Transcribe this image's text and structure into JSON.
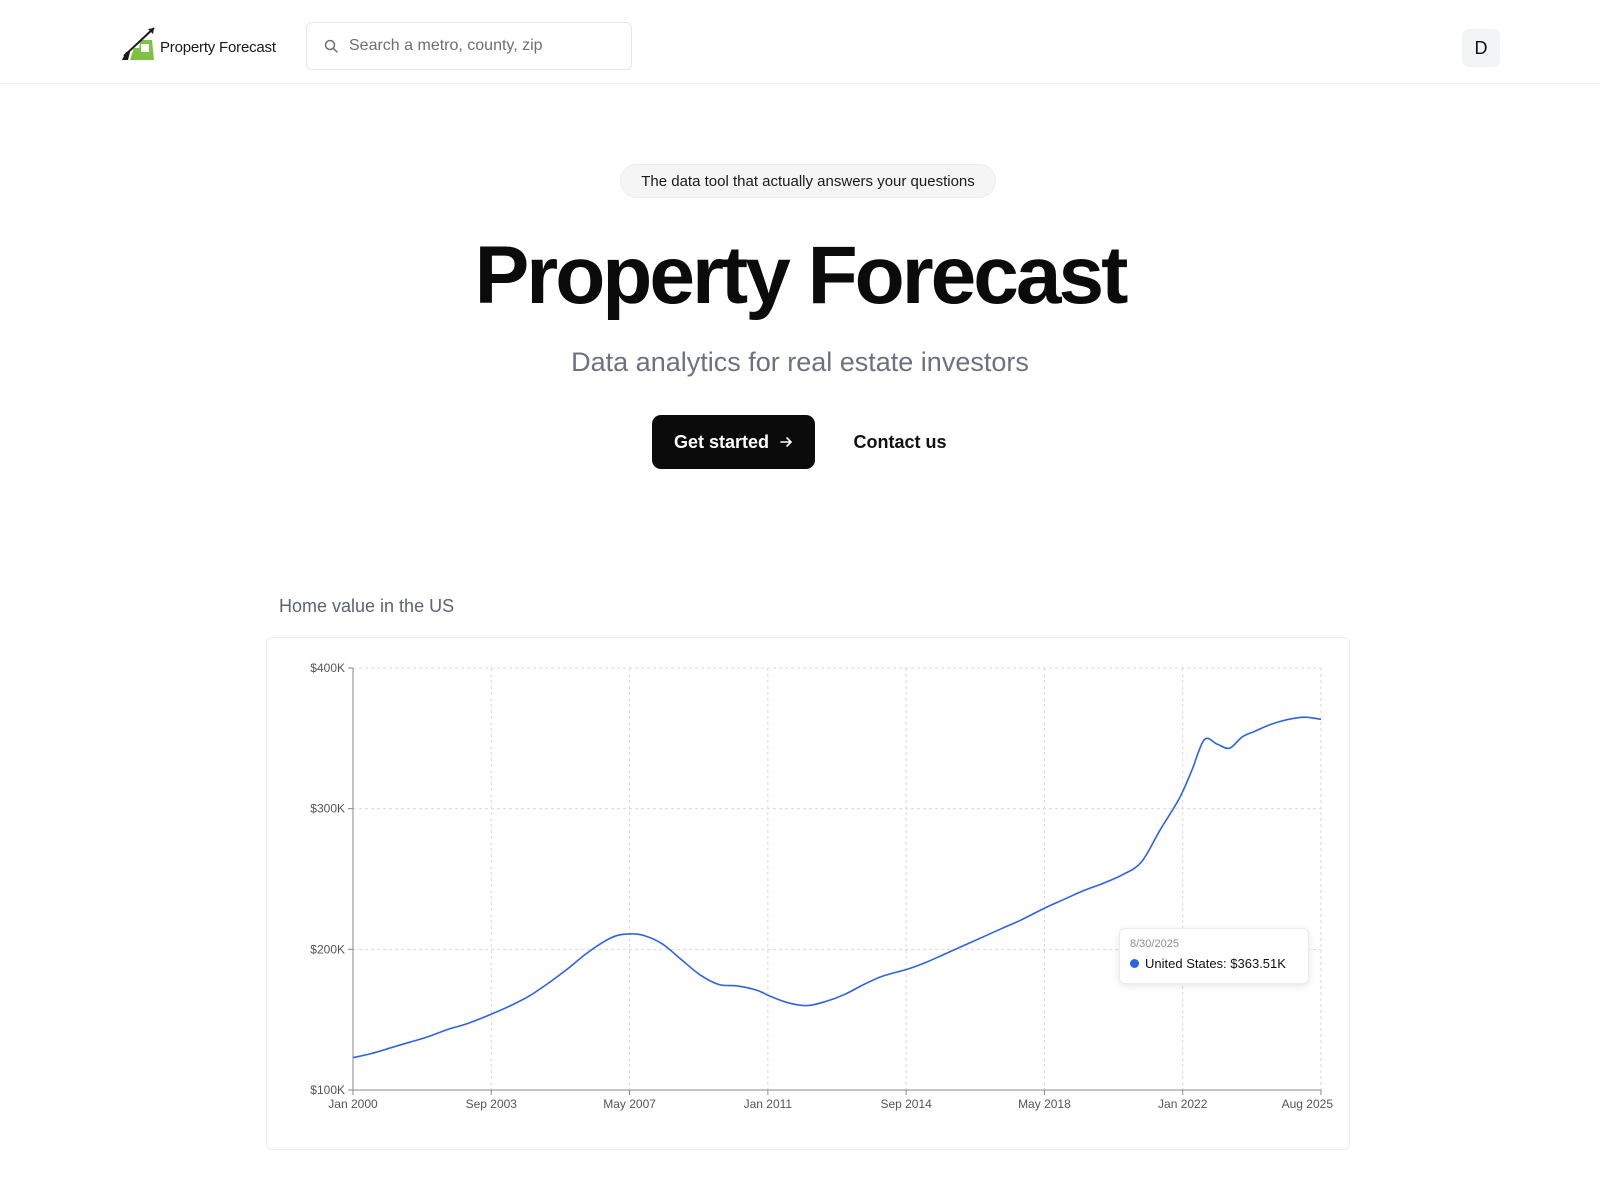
{
  "header": {
    "logo_text": "Property Forecast",
    "search_placeholder": "Search a metro, county, zip",
    "avatar_initial": "D"
  },
  "hero": {
    "tagline": "The data tool that actually answers your questions",
    "title": "Property Forecast",
    "subtitle": "Data analytics for real estate investors",
    "primary_button": "Get started",
    "secondary_button": "Contact us"
  },
  "colors": {
    "line": "#2e63e0",
    "logo_green": "#7dc242",
    "primary_button_bg": "#0b0b0b"
  },
  "chart_data": {
    "type": "line",
    "title": "Home value in the US",
    "series": [
      {
        "name": "United States",
        "x": [
          "2000-01",
          "2000-07",
          "2001-01",
          "2001-07",
          "2002-01",
          "2002-07",
          "2003-01",
          "2003-09",
          "2004-03",
          "2004-09",
          "2005-03",
          "2005-09",
          "2006-03",
          "2006-09",
          "2007-01",
          "2007-05",
          "2007-09",
          "2008-03",
          "2008-09",
          "2009-03",
          "2009-09",
          "2010-03",
          "2010-09",
          "2011-01",
          "2011-07",
          "2012-01",
          "2012-07",
          "2013-01",
          "2013-07",
          "2014-01",
          "2014-09",
          "2015-03",
          "2015-09",
          "2016-03",
          "2016-09",
          "2017-03",
          "2017-09",
          "2018-05",
          "2018-11",
          "2019-05",
          "2019-11",
          "2020-05",
          "2020-11",
          "2021-05",
          "2021-11",
          "2022-03",
          "2022-07",
          "2022-11",
          "2023-03",
          "2023-07",
          "2023-11",
          "2024-03",
          "2024-07",
          "2024-11",
          "2025-03",
          "2025-08"
        ],
        "values": [
          123,
          126,
          130,
          134,
          138,
          143,
          147,
          154,
          160,
          167,
          176,
          186,
          197,
          206,
          210,
          211,
          210,
          204,
          193,
          182,
          175,
          174,
          171,
          167,
          162,
          160,
          163,
          168,
          175,
          181,
          186,
          191,
          197,
          203,
          209,
          215,
          221,
          230,
          236,
          242,
          247,
          253,
          262,
          285,
          307,
          327,
          349,
          346,
          343,
          351,
          355,
          359,
          362,
          364,
          365,
          363.51
        ]
      }
    ],
    "x_ticks": [
      "Jan 2000",
      "Sep 2003",
      "May 2007",
      "Jan 2011",
      "Sep 2014",
      "May 2018",
      "Jan 2022",
      "Aug 2025"
    ],
    "y_ticks": [
      "$100K",
      "$200K",
      "$300K",
      "$400K"
    ],
    "ylim": [
      100,
      400
    ],
    "y_unit": "thousand USD",
    "grid": true,
    "tooltip": {
      "date": "8/30/2025",
      "label": "United States: $363.51K"
    }
  }
}
